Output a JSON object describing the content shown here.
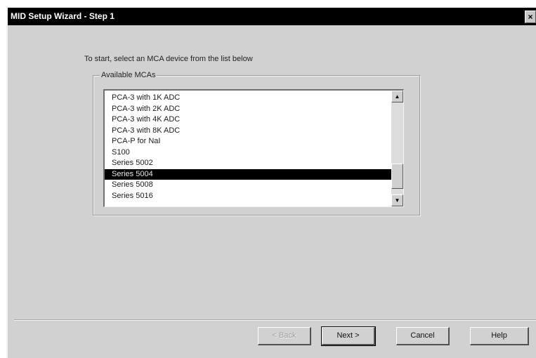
{
  "window": {
    "title": "MID Setup Wizard - Step 1",
    "close_glyph": "×"
  },
  "instruction": "To start, select an MCA device from the list below",
  "group": {
    "label": "Available MCAs"
  },
  "list": {
    "items": [
      "PCA-3 with 1K ADC",
      "PCA-3 with 2K ADC",
      "PCA-3 with 4K ADC",
      "PCA-3 with 8K ADC",
      "PCA-P for NaI",
      "S100",
      "Series 5002",
      "Series 5004",
      "Series 5008",
      "Series 5016"
    ],
    "selected_index": 7,
    "scroll_up_glyph": "▲",
    "scroll_down_glyph": "▼"
  },
  "buttons": {
    "back": "< Back",
    "next": "Next >",
    "cancel": "Cancel",
    "help": "Help"
  },
  "colors": {
    "dialog_bg": "#d1d1d1",
    "titlebar_bg": "#000000",
    "selection_bg": "#000000"
  }
}
